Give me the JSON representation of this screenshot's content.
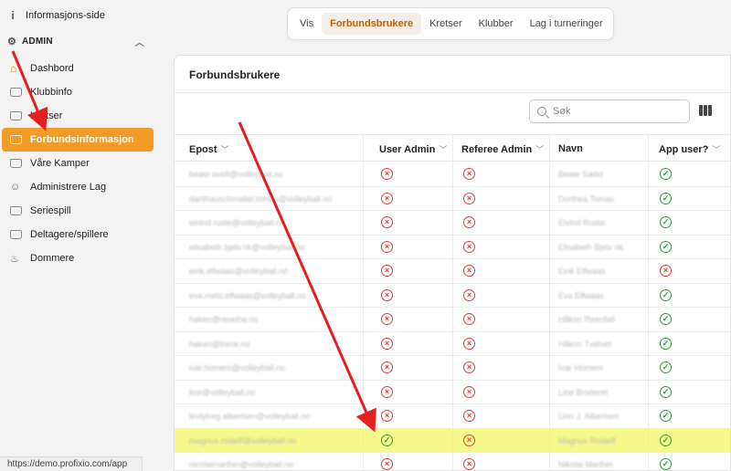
{
  "sidebar": {
    "info_label": "Informasjons-side",
    "admin_label": "ADMIN",
    "items": [
      {
        "label": "Dashbord",
        "icon": "home-icon"
      },
      {
        "label": "Klubbinfo",
        "icon": "folder-icon"
      },
      {
        "label": "Kretser",
        "icon": "folder-icon"
      },
      {
        "label": "Forbundsinformasjon",
        "icon": "folder-icon",
        "active": true
      },
      {
        "label": "Våre Kamper",
        "icon": "folder-icon"
      },
      {
        "label": "Administrere Lag",
        "icon": "people-icon"
      },
      {
        "label": "Seriespill",
        "icon": "folder-icon"
      },
      {
        "label": "Deltagere/spillere",
        "icon": "folder-icon"
      },
      {
        "label": "Dommere",
        "icon": "whistle-icon"
      }
    ]
  },
  "status_url": "https://demo.profixio.com/app",
  "tabs": [
    "Vis",
    "Forbundsbrukere",
    "Kretser",
    "Klubber",
    "Lag i turneringer"
  ],
  "panel": {
    "title": "Forbundsbrukere",
    "search_placeholder": "Søk"
  },
  "table": {
    "headers": {
      "epost": "Epost",
      "user_admin": "User Admin",
      "referee_admin": "Referee Admin",
      "navn": "Navn",
      "app_user": "App user?"
    },
    "rows": [
      {
        "epost": "beate.ovelt@volleyball.no",
        "navn": "Beate Sælid",
        "user_admin": false,
        "referee_admin": false,
        "app_user": true
      },
      {
        "epost": "danthauschmaller.tomas@volleyball.no",
        "navn": "Dorthea Tomas",
        "user_admin": false,
        "referee_admin": false,
        "app_user": true
      },
      {
        "epost": "einind.ruste@volleyball.no",
        "navn": "Eivind Rustø",
        "user_admin": false,
        "referee_admin": false,
        "app_user": true
      },
      {
        "epost": "elisabeth.bjelv.rik@volleyball.no",
        "navn": "Elisabeth Bjelv rik",
        "user_admin": false,
        "referee_admin": false,
        "app_user": true
      },
      {
        "epost": "eirik.elfwaas@volleyball.no",
        "navn": "Eirik Elfwaas",
        "user_admin": false,
        "referee_admin": false,
        "app_user": false
      },
      {
        "epost": "eva.mets.elfwaas@volleyball.no",
        "navn": "Eva Elfwaas",
        "user_admin": false,
        "referee_admin": false,
        "app_user": true
      },
      {
        "epost": "haken@reveiha.no",
        "navn": "Håkon Reenfall",
        "user_admin": false,
        "referee_admin": false,
        "app_user": true
      },
      {
        "epost": "haken@trene.no",
        "navn": "Håkon Tvetvet",
        "user_admin": false,
        "referee_admin": false,
        "app_user": true
      },
      {
        "epost": "ivar.homem@volleyball.no",
        "navn": "Ivar Homem",
        "user_admin": false,
        "referee_admin": false,
        "app_user": true
      },
      {
        "epost": "line@volleyball.no",
        "navn": "Line Broderet",
        "user_admin": false,
        "referee_admin": false,
        "app_user": true
      },
      {
        "epost": "lindytreg.albertsen@volleyball.no",
        "navn": "Linn J. Albertsen",
        "user_admin": false,
        "referee_admin": false,
        "app_user": true
      },
      {
        "epost": "magnus.rosleff@volleyball.no",
        "navn": "Magnus Rosleff",
        "user_admin": true,
        "referee_admin": false,
        "app_user": true,
        "highlight": true
      },
      {
        "epost": "nicolaimarthin@volleyball.no",
        "navn": "Nikolai Marthin",
        "user_admin": false,
        "referee_admin": false,
        "app_user": true
      }
    ]
  },
  "colors": {
    "accent": "#f39a27",
    "ok": "#2f9a35",
    "no": "#d9403a",
    "highlight": "#f2f864",
    "arrow": "#e61e1e"
  }
}
